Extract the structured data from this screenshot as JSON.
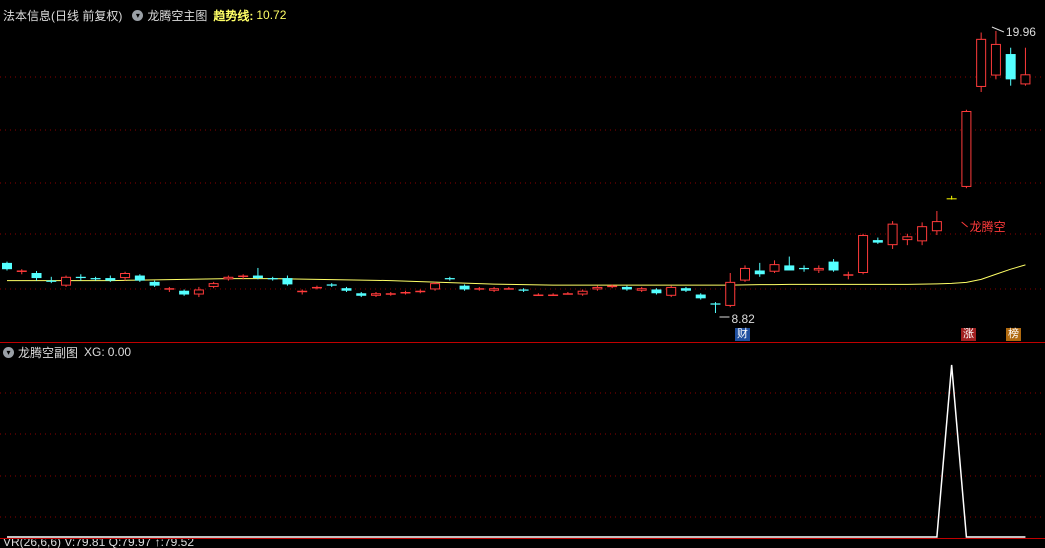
{
  "main_header": {
    "stock": "法本信息(日线 前复权)",
    "indicator": "龙腾空主图",
    "trend_label": "趋势线:",
    "trend_value": "10.72"
  },
  "sub_header": {
    "indicator": "龙腾空副图",
    "xg_label": "XG:",
    "xg_value": "0.00"
  },
  "bottom_header": {
    "text": "VR(26,6,6)  V:79.81  Q:79.97  ↑:79.52"
  },
  "annotations": {
    "high_label": "19.96",
    "low_label": "8.82",
    "signal_label": "龙腾空",
    "badges": [
      "财",
      "涨",
      "榜"
    ]
  },
  "colors": {
    "up": "#ff3b3b",
    "down": "#54ffff",
    "trend_line": "#ffff66",
    "signal": "#ffff00",
    "grid": "#8b0000",
    "xg_line": "#ffffff"
  },
  "chart_data": [
    {
      "type": "candlestick",
      "title": "龙腾空主图",
      "series": [
        {
          "name": "K线",
          "ohlc": [
            [
              10.8,
              10.85,
              10.5,
              10.55
            ],
            [
              10.45,
              10.55,
              10.35,
              10.5
            ],
            [
              10.4,
              10.48,
              10.1,
              10.2
            ],
            [
              10.1,
              10.25,
              10.0,
              10.05
            ],
            [
              9.9,
              10.3,
              9.85,
              10.25
            ],
            [
              10.25,
              10.35,
              10.1,
              10.2
            ],
            [
              10.2,
              10.25,
              10.1,
              10.15
            ],
            [
              10.2,
              10.3,
              10.05,
              10.1
            ],
            [
              10.2,
              10.45,
              10.1,
              10.4
            ],
            [
              10.3,
              10.35,
              10.05,
              10.1
            ],
            [
              10.05,
              10.1,
              9.85,
              9.9
            ],
            [
              9.75,
              9.85,
              9.65,
              9.8
            ],
            [
              9.7,
              9.75,
              9.5,
              9.55
            ],
            [
              9.55,
              9.85,
              9.45,
              9.75
            ],
            [
              9.85,
              10.05,
              9.8,
              10.0
            ],
            [
              10.15,
              10.3,
              10.1,
              10.25
            ],
            [
              10.25,
              10.35,
              10.15,
              10.3
            ],
            [
              10.3,
              10.6,
              10.15,
              10.2
            ],
            [
              10.2,
              10.25,
              10.1,
              10.15
            ],
            [
              10.2,
              10.3,
              9.9,
              9.95
            ],
            [
              9.65,
              9.75,
              9.55,
              9.7
            ],
            [
              9.8,
              9.9,
              9.75,
              9.85
            ],
            [
              9.95,
              10.0,
              9.85,
              9.9
            ],
            [
              9.8,
              9.85,
              9.65,
              9.7
            ],
            [
              9.6,
              9.65,
              9.45,
              9.5
            ],
            [
              9.5,
              9.65,
              9.45,
              9.6
            ],
            [
              9.55,
              9.65,
              9.5,
              9.6
            ],
            [
              9.6,
              9.7,
              9.55,
              9.65
            ],
            [
              9.65,
              9.75,
              9.6,
              9.7
            ],
            [
              9.75,
              10.05,
              9.7,
              10.0
            ],
            [
              10.2,
              10.25,
              10.1,
              10.15
            ],
            [
              9.9,
              9.95,
              9.7,
              9.75
            ],
            [
              9.8,
              9.85,
              9.7,
              9.8
            ],
            [
              9.7,
              9.85,
              9.65,
              9.8
            ],
            [
              9.8,
              9.85,
              9.75,
              9.8
            ],
            [
              9.75,
              9.8,
              9.65,
              9.7
            ],
            [
              9.55,
              9.6,
              9.5,
              9.55
            ],
            [
              9.55,
              9.6,
              9.5,
              9.55
            ],
            [
              9.6,
              9.65,
              9.55,
              9.6
            ],
            [
              9.55,
              9.75,
              9.5,
              9.7
            ],
            [
              9.75,
              9.9,
              9.7,
              9.85
            ],
            [
              9.85,
              9.95,
              9.8,
              9.9
            ],
            [
              9.85,
              9.9,
              9.7,
              9.75
            ],
            [
              9.7,
              9.85,
              9.65,
              9.8
            ],
            [
              9.75,
              9.8,
              9.55,
              9.6
            ],
            [
              9.5,
              9.9,
              9.45,
              9.85
            ],
            [
              9.8,
              9.85,
              9.65,
              9.7
            ],
            [
              9.55,
              9.6,
              9.35,
              9.4
            ],
            [
              9.2,
              9.25,
              8.82,
              9.15
            ],
            [
              9.1,
              10.4,
              9.05,
              10.05
            ],
            [
              10.1,
              10.7,
              10.05,
              10.6
            ],
            [
              10.5,
              10.8,
              10.25,
              10.35
            ],
            [
              10.45,
              10.9,
              10.4,
              10.75
            ],
            [
              10.7,
              11.05,
              10.6,
              10.5
            ],
            [
              10.6,
              10.7,
              10.45,
              10.55
            ],
            [
              10.5,
              10.7,
              10.4,
              10.6
            ],
            [
              10.85,
              10.95,
              10.45,
              10.5
            ],
            [
              10.3,
              10.45,
              10.15,
              10.35
            ],
            [
              10.4,
              11.95,
              10.35,
              11.9
            ],
            [
              11.7,
              11.8,
              11.55,
              11.6
            ],
            [
              11.5,
              12.45,
              11.35,
              12.35
            ],
            [
              11.7,
              11.95,
              11.5,
              11.85
            ],
            [
              11.65,
              12.4,
              11.5,
              12.25
            ],
            [
              12.05,
              12.85,
              11.9,
              12.45
            ],
            [
              13.35,
              13.45,
              13.3,
              13.35
            ],
            [
              13.8,
              16.85,
              13.75,
              16.8
            ],
            [
              17.75,
              19.9,
              17.55,
              19.65
            ],
            [
              18.2,
              19.96,
              18.05,
              19.45
            ],
            [
              19.05,
              19.3,
              17.8,
              18.05
            ],
            [
              17.85,
              19.3,
              17.8,
              18.25
            ]
          ],
          "signal_candles": [
            64
          ]
        },
        {
          "name": "趋势线",
          "values": [
            10.1,
            10.1,
            10.1,
            10.1,
            10.1,
            10.1,
            10.1,
            10.1,
            10.11,
            10.12,
            10.13,
            10.14,
            10.15,
            10.16,
            10.17,
            10.18,
            10.18,
            10.18,
            10.18,
            10.17,
            10.16,
            10.15,
            10.14,
            10.13,
            10.12,
            10.11,
            10.1,
            10.08,
            10.06,
            10.04,
            10.02,
            10.0,
            9.98,
            9.96,
            9.95,
            9.94,
            9.93,
            9.92,
            9.92,
            9.92,
            9.92,
            9.92,
            9.92,
            9.92,
            9.92,
            9.92,
            9.92,
            9.92,
            9.92,
            9.92,
            9.93,
            9.94,
            9.94,
            9.95,
            9.95,
            9.95,
            9.95,
            9.95,
            9.95,
            9.95,
            9.95,
            9.95,
            9.96,
            9.97,
            9.99,
            10.03,
            10.15,
            10.35,
            10.55,
            10.72
          ]
        }
      ],
      "high_marker": {
        "index": 67,
        "value": 19.96
      },
      "low_marker": {
        "index": 48,
        "value": 8.82
      }
    },
    {
      "type": "line",
      "title": "龙腾空副图",
      "series": [
        {
          "name": "XG",
          "values": [
            0,
            0,
            0,
            0,
            0,
            0,
            0,
            0,
            0,
            0,
            0,
            0,
            0,
            0,
            0,
            0,
            0,
            0,
            0,
            0,
            0,
            0,
            0,
            0,
            0,
            0,
            0,
            0,
            0,
            0,
            0,
            0,
            0,
            0,
            0,
            0,
            0,
            0,
            0,
            0,
            0,
            0,
            0,
            0,
            0,
            0,
            0,
            0,
            0,
            0,
            0,
            0,
            0,
            0,
            0,
            0,
            0,
            0,
            0,
            0,
            0,
            0,
            0,
            0,
            1,
            0,
            0,
            0,
            0,
            0
          ]
        }
      ]
    }
  ]
}
